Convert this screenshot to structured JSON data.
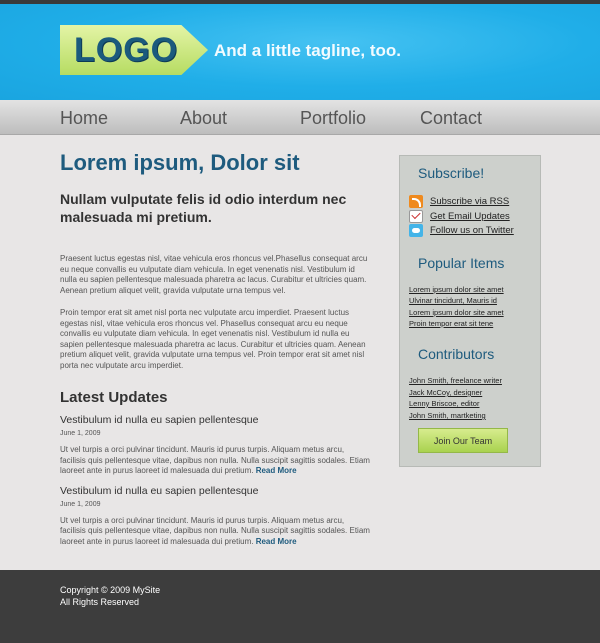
{
  "header": {
    "logo": "LOGO",
    "tagline": "And a little tagline, too."
  },
  "nav": {
    "items": [
      {
        "label": "Home"
      },
      {
        "label": "About"
      },
      {
        "label": "Portfolio"
      },
      {
        "label": "Contact"
      }
    ]
  },
  "main": {
    "title": "Lorem ipsum, Dolor sit",
    "subtitle": "Nullam vulputate felis id odio interdum nec malesuada mi pretium.",
    "paragraphs": [
      "Praesent luctus egestas nisl, vitae vehicula eros rhoncus vel.Phasellus consequat arcu eu neque convallis eu vulputate diam vehicula. In eget venenatis nisl. Vestibulum id nulla eu sapien pellentesque malesuada pharetra ac lacus. Curabitur et ultricies quam. Aenean pretium aliquet velit, gravida vulputate urna tempus vel.",
      "Proin tempor erat sit amet nisl porta nec vulputate arcu imperdiet. Praesent luctus egestas nisl, vitae vehicula eros rhoncus vel. Phasellus consequat arcu eu neque convallis eu vulputate diam vehicula. In eget venenatis nisl. Vestibulum id nulla eu sapien pellentesque malesuada pharetra ac lacus. Curabitur et ultricies quam. Aenean pretium aliquet velit, gravida vulputate urna tempus vel. Proin tempor erat sit amet nisl porta nec vulputate arcu imperdiet."
    ],
    "updates_title": "Latest Updates",
    "updates": [
      {
        "title": "Vestibulum id nulla eu sapien pellentesque",
        "date": "June 1, 2009",
        "body": "Ut vel turpis a orci pulvinar tincidunt. Mauris id purus turpis. Aliquam metus arcu, facilisis quis pellentesque vitae, dapibus non nulla. Nulla suscipit sagittis sodales. Etiam laoreet ante in purus laoreet id malesuada dui pretium.",
        "read_more": "Read More"
      },
      {
        "title": "Vestibulum id nulla eu sapien pellentesque",
        "date": "June 1, 2009",
        "body": "Ut vel turpis a orci pulvinar tincidunt. Mauris id purus turpis. Aliquam metus arcu, facilisis quis pellentesque vitae, dapibus non nulla. Nulla suscipit sagittis sodales. Etiam laoreet ante in purus laoreet id malesuada dui pretium.",
        "read_more": "Read More"
      }
    ]
  },
  "sidebar": {
    "subscribe_title": "Subscribe!",
    "subscribe_links": [
      {
        "label": "Subscribe via RSS",
        "icon": "rss-icon"
      },
      {
        "label": "Get Email Updates",
        "icon": "email-icon"
      },
      {
        "label": "Follow us on Twitter",
        "icon": "twitter-icon"
      }
    ],
    "popular_title": "Popular Items",
    "popular_links": [
      "Lorem ipsum dolor site amet",
      "Ulvinar tincidunt, Mauris id",
      "Lorem ipsum dolor site amet",
      "Proin tempor erat sit tene"
    ],
    "contributors_title": "Contributors",
    "contributors": [
      "John Smith, freelance writer",
      "Jack McCoy, designer",
      "Lenny Briscoe, editor",
      "John Smith, martketing"
    ],
    "join_label": "Join Our Team"
  },
  "footer": {
    "copyright": "Copyright © 2009 MySite",
    "rights": "All Rights Reserved"
  },
  "colors": {
    "header_blue": "#20aee8",
    "title_blue": "#1e5b7e",
    "logo_green": "#b6dc62",
    "footer_dark": "#3d3d3d"
  }
}
